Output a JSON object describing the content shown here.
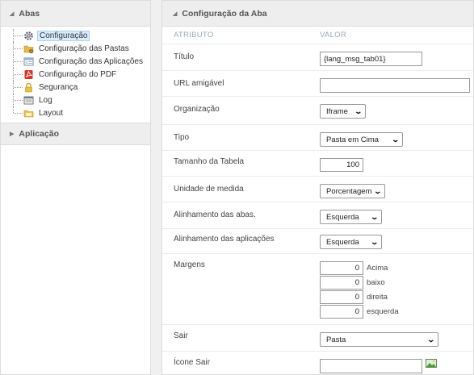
{
  "sidebar": {
    "header": "Abas",
    "items": [
      {
        "label": "Configuração",
        "icon": "gear-icon",
        "active": true
      },
      {
        "label": "Configuração das Pastas",
        "icon": "folder-icon"
      },
      {
        "label": "Configuração das Aplicações",
        "icon": "application-window-icon"
      },
      {
        "label": "Configuração do PDF",
        "icon": "pdf-icon"
      },
      {
        "label": "Segurança",
        "icon": "lock-icon"
      },
      {
        "label": "Log",
        "icon": "log-icon"
      },
      {
        "label": "Layout",
        "icon": "layout-folder-icon"
      }
    ],
    "section2": "Aplicação"
  },
  "main": {
    "header": "Configuração da Aba",
    "col_attr": "ATRIBUTO",
    "col_value": "VALOR",
    "fields": {
      "titulo": {
        "label": "Título",
        "value": "{lang_msg_tab01}"
      },
      "url": {
        "label": "URL amigável",
        "value": ""
      },
      "organizacao": {
        "label": "Organização",
        "value": "Iframe"
      },
      "tipo": {
        "label": "Tipo",
        "value": "Pasta em Cima"
      },
      "tamanho": {
        "label": "Tamanho da Tabela",
        "value": "100"
      },
      "unidade": {
        "label": "Unidade de medida",
        "value": "Porcentagem"
      },
      "alinh_abas": {
        "label": "Alinhamento das abas.",
        "value": "Esquerda"
      },
      "alinh_apps": {
        "label": "Alinhamento das aplicações",
        "value": "Esquerda"
      },
      "margens": {
        "label": "Margens",
        "items": [
          {
            "value": "0",
            "unit": "Acima"
          },
          {
            "value": "0",
            "unit": "baixo"
          },
          {
            "value": "0",
            "unit": "direita"
          },
          {
            "value": "0",
            "unit": "esquerda"
          }
        ]
      },
      "sair": {
        "label": "Sair",
        "value": "Pasta"
      },
      "icone_sair": {
        "label": "Ícone Sair",
        "value": ""
      }
    }
  },
  "colors": {
    "accent": "#d9ecff",
    "border": "#dcdcdc",
    "header_bg": "#eeeeee"
  }
}
